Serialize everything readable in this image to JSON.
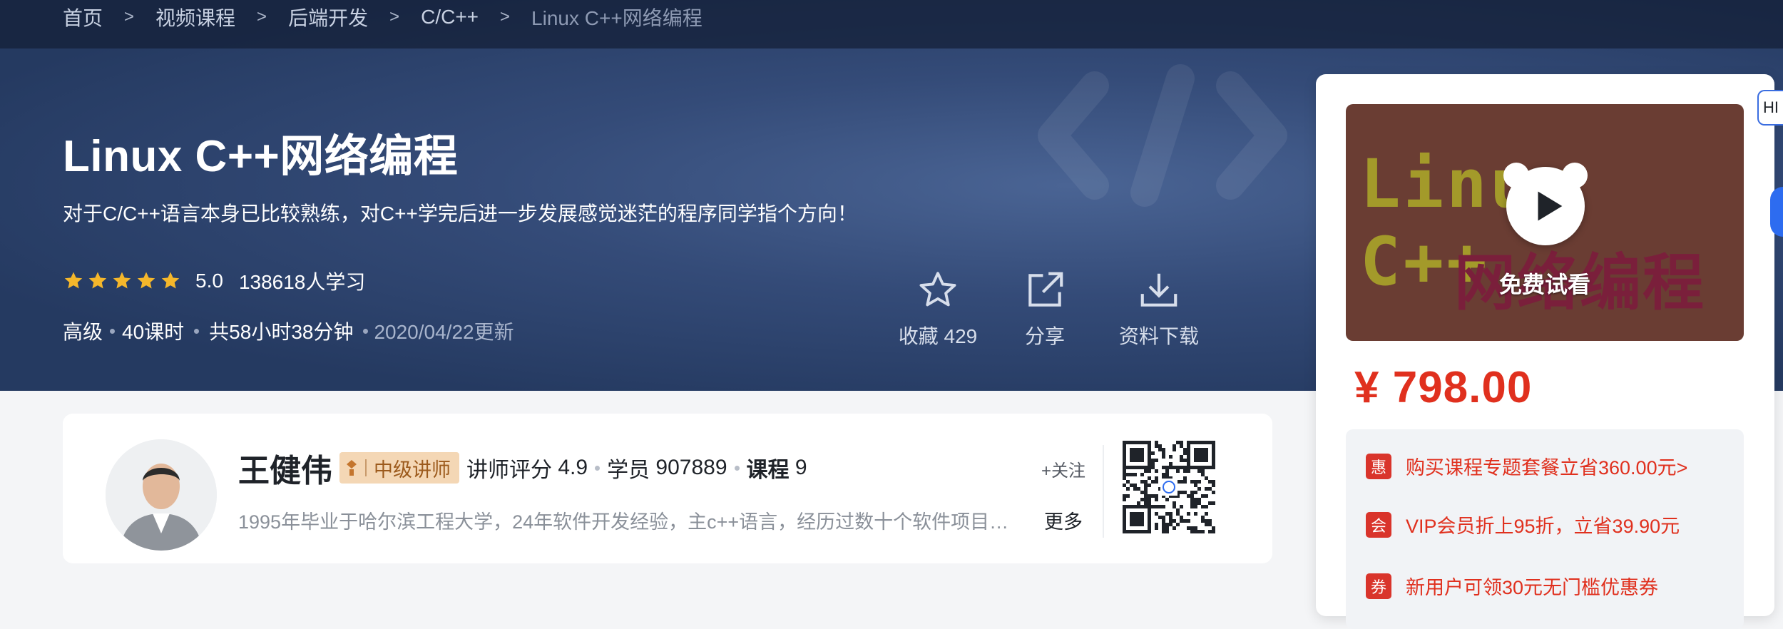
{
  "breadcrumb": [
    {
      "label": "首页"
    },
    {
      "label": "视频课程"
    },
    {
      "label": "后端开发"
    },
    {
      "label": "C/C++"
    },
    {
      "label": "Linux C++网络编程"
    }
  ],
  "breadcrumb_separator": ">",
  "course": {
    "title": "Linux C++网络编程",
    "subtitle": "对于C/C++语言本身已比较熟练，对C++学完后进一步发展感觉迷茫的程序同学指个方向！",
    "rating": 5.0,
    "rating_text": "5.0",
    "learners": "138618人学习",
    "level": "高级",
    "lessons": "40课时",
    "duration": "共58小时38分钟",
    "updated": "2020/04/22更新"
  },
  "actions": {
    "favorite_label": "收藏",
    "favorite_count": "429",
    "share_label": "分享",
    "download_label": "资料下载"
  },
  "side": {
    "cover_line1": "Linux C++",
    "cover_line2": "网络编程",
    "free_trial": "免费试看",
    "price": "¥ 798.00",
    "promos": [
      {
        "tag": "惠",
        "text": "购买课程专题套餐立省360.00元>"
      },
      {
        "tag": "会",
        "text": "VIP会员折上95折，立省39.90元"
      },
      {
        "tag": "券",
        "text": "新用户可领30元无门槛优惠券"
      }
    ],
    "hi_tab": "HI"
  },
  "teacher": {
    "name": "王健伟",
    "badge": "中级讲师",
    "score_label": "讲师评分",
    "score": "4.9",
    "students_label": "学员",
    "students": "907889",
    "courses_label": "课程",
    "courses": "9",
    "follow": "+关注",
    "description": "1995年毕业于哈尔滨工程大学，24年软件开发经验，主c++语言，经历过数十个软件项目…",
    "more": "更多"
  },
  "colors": {
    "hero_bg": "#2b416b",
    "accent_red": "#e0301e",
    "star": "#f5b72b",
    "badge_bg": "#f4d7b5"
  },
  "icons": [
    "star-outline-icon",
    "share-icon",
    "download-icon",
    "play-icon",
    "qr-code-icon"
  ]
}
